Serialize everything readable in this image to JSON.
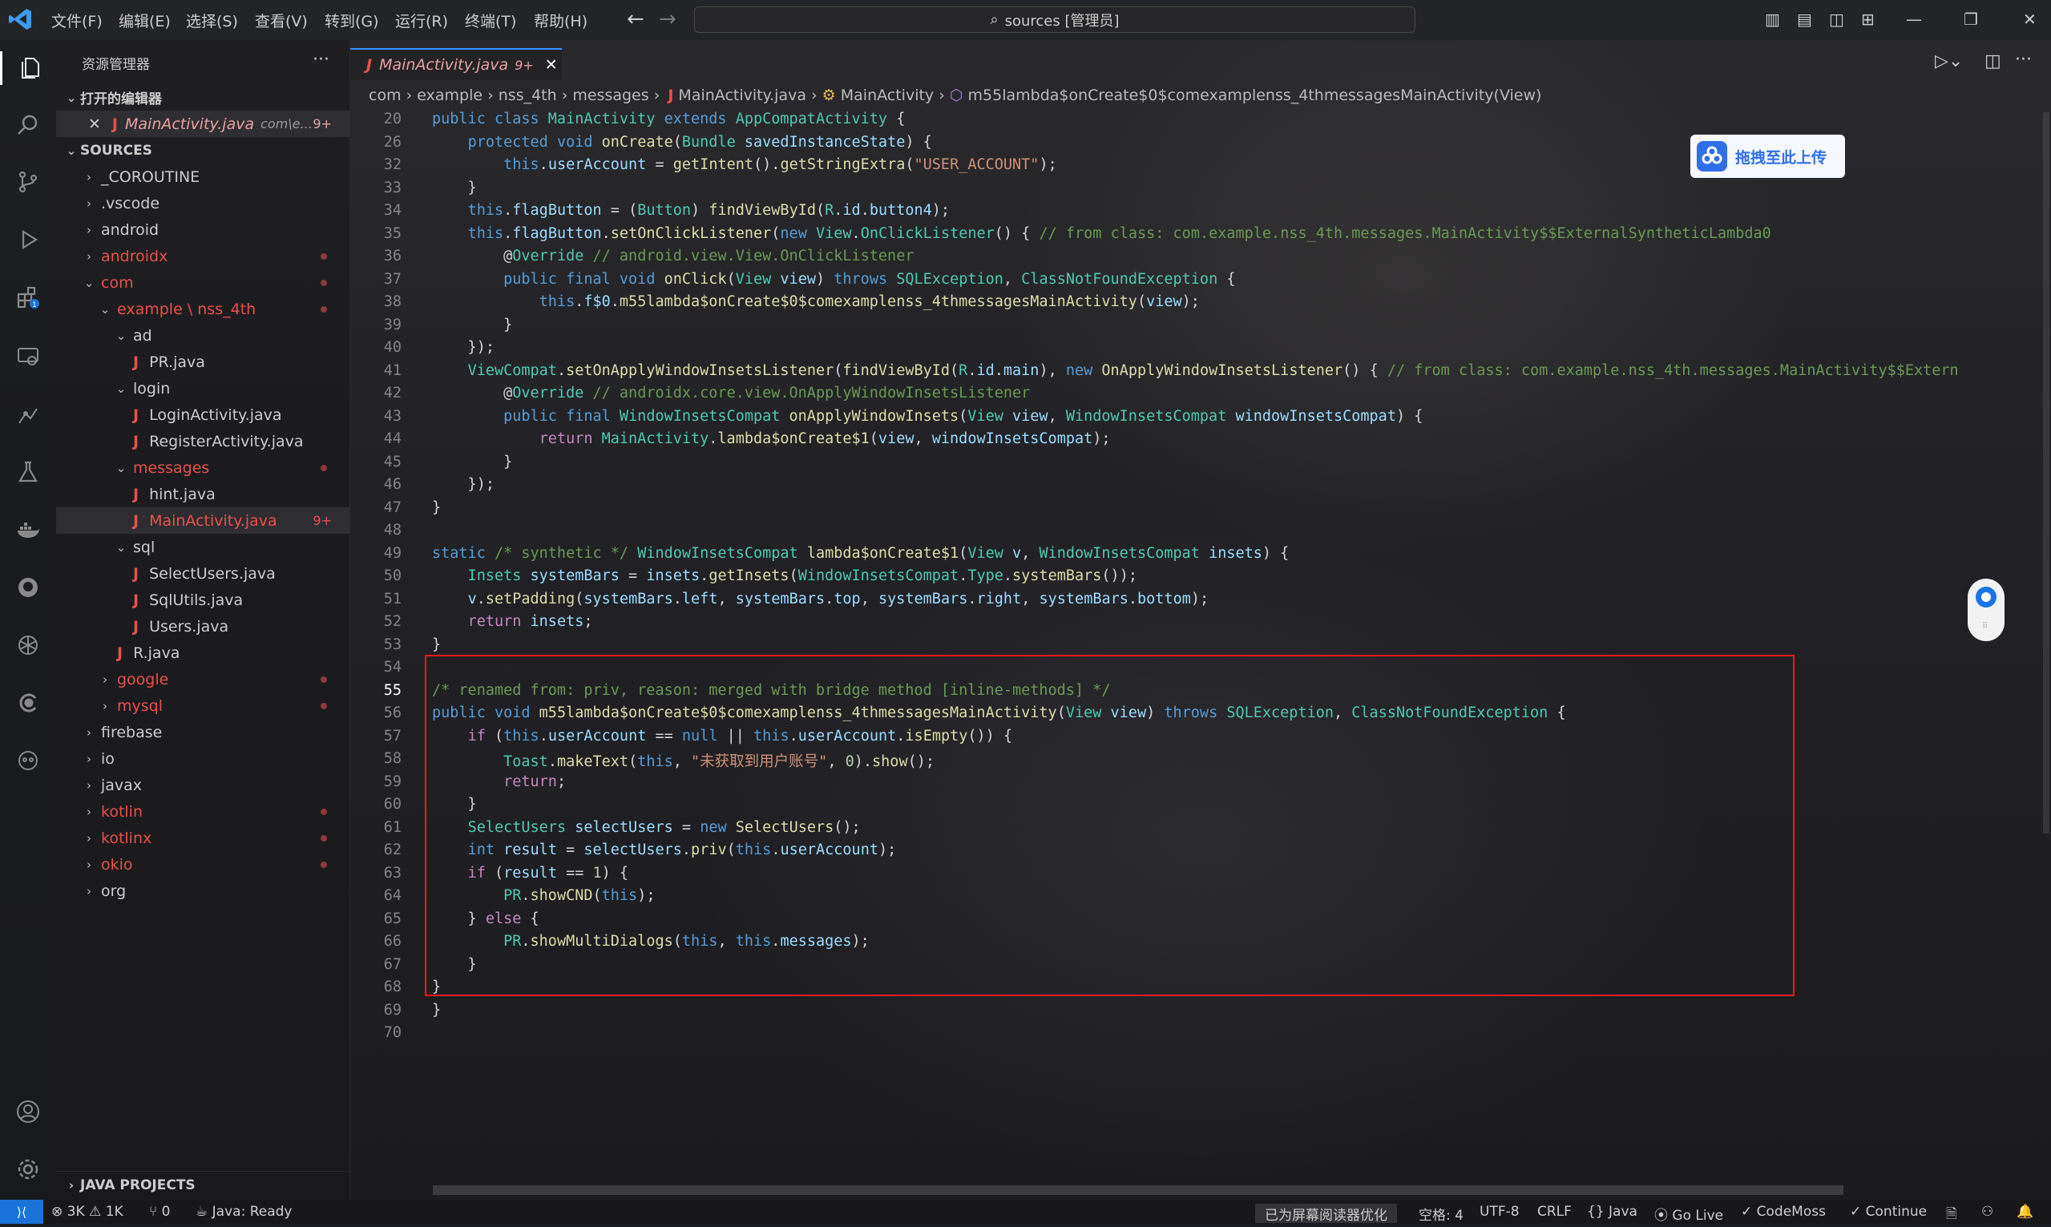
{
  "titlebar": {
    "menus": [
      "文件(F)",
      "编辑(E)",
      "选择(S)",
      "查看(V)",
      "转到(G)",
      "运行(R)",
      "终端(T)",
      "帮助(H)"
    ],
    "search_text": "sources [管理员]"
  },
  "sidebar": {
    "title": "资源管理器",
    "open_editors_label": "打开的编辑器",
    "open_editor": {
      "name": "MainActivity.java",
      "path": "com\\e...",
      "badge": "9+"
    },
    "sources_label": "SOURCES",
    "tree": [
      {
        "label": "_COROUTINE",
        "type": "folder"
      },
      {
        "label": ".vscode",
        "type": "folder"
      },
      {
        "label": "android",
        "type": "folder"
      },
      {
        "label": "androidx",
        "type": "folder"
      },
      {
        "label": "com",
        "type": "folder"
      },
      {
        "label": "example \\ nss_4th",
        "type": "folder"
      },
      {
        "label": "ad",
        "type": "folder"
      },
      {
        "label": "PR.java",
        "type": "file"
      },
      {
        "label": "login",
        "type": "folder"
      },
      {
        "label": "LoginActivity.java",
        "type": "file"
      },
      {
        "label": "RegisterActivity.java",
        "type": "file"
      },
      {
        "label": "messages",
        "type": "folder"
      },
      {
        "label": "hint.java",
        "type": "file"
      },
      {
        "label": "MainActivity.java",
        "type": "file",
        "badge": "9+"
      },
      {
        "label": "sql",
        "type": "folder"
      },
      {
        "label": "SelectUsers.java",
        "type": "file"
      },
      {
        "label": "SqlUtils.java",
        "type": "file"
      },
      {
        "label": "Users.java",
        "type": "file"
      },
      {
        "label": "R.java",
        "type": "file"
      },
      {
        "label": "google",
        "type": "folder"
      },
      {
        "label": "mysql",
        "type": "folder"
      },
      {
        "label": "firebase",
        "type": "folder"
      },
      {
        "label": "io",
        "type": "folder"
      },
      {
        "label": "javax",
        "type": "folder"
      },
      {
        "label": "kotlin",
        "type": "folder"
      },
      {
        "label": "kotlinx",
        "type": "folder"
      },
      {
        "label": "okio",
        "type": "folder"
      },
      {
        "label": "org",
        "type": "folder"
      }
    ],
    "java_projects_label": "JAVA PROJECTS"
  },
  "editor": {
    "tab": {
      "name": "MainActivity.java",
      "badge": "9+"
    },
    "breadcrumb": [
      "com",
      "example",
      "nss_4th",
      "messages",
      "MainActivity.java",
      "MainActivity",
      "m55lambda$onCreate$0$comexamplenss_4thmessagesMainActivity(View)"
    ],
    "line_numbers": [
      "20",
      "26",
      "32",
      "33",
      "34",
      "35",
      "36",
      "37",
      "38",
      "39",
      "40",
      "41",
      "42",
      "43",
      "44",
      "45",
      "46",
      "47",
      "48",
      "49",
      "50",
      "51",
      "52",
      "53",
      "54",
      "55",
      "56",
      "57",
      "58",
      "59",
      "60",
      "61",
      "62",
      "63",
      "64",
      "65",
      "66",
      "67",
      "68",
      "69",
      "70"
    ],
    "upload_label": "拖拽至此上传"
  },
  "statusbar": {
    "problems_errors": "3K",
    "problems_warnings": "1K",
    "ports": "0",
    "java_status": "Java: Ready",
    "screen_reader": "已为屏幕阅读器优化",
    "indent": "空格: 4",
    "encoding": "UTF-8",
    "eol": "CRLF",
    "language": "Java",
    "go_live": "Go Live",
    "codemoss": "CodeMoss",
    "continue": "Continue"
  },
  "colors": {
    "accent": "#3794ff",
    "highlight_box": "#e81b1b",
    "error_file": "#e8504a"
  }
}
